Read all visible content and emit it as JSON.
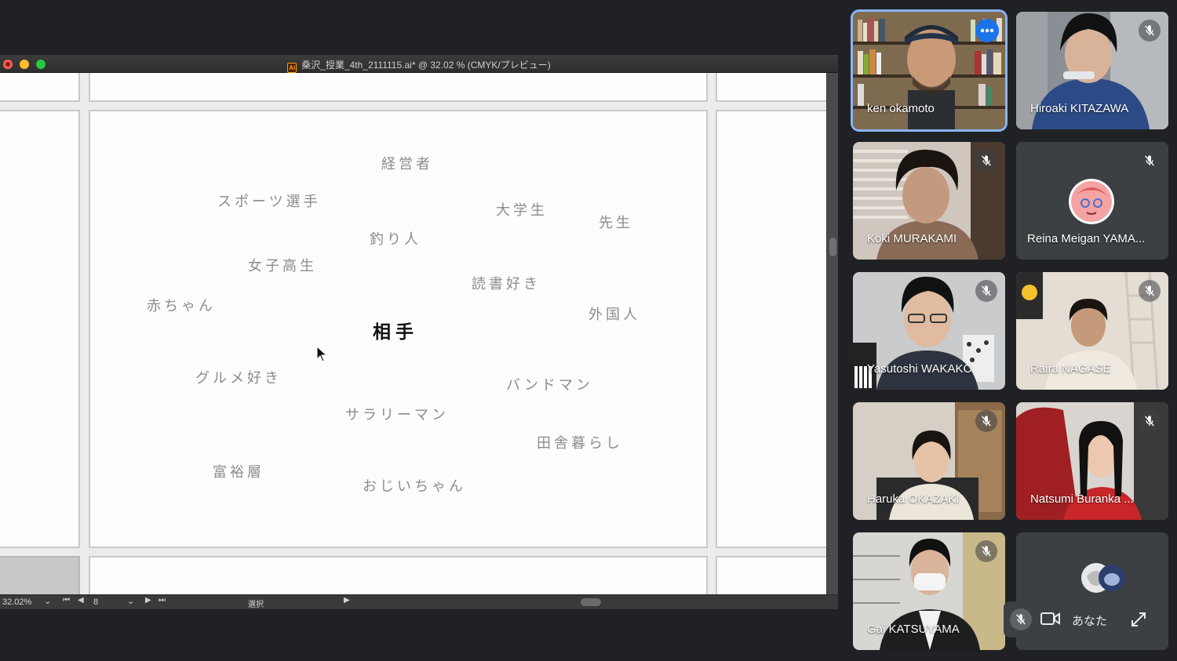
{
  "illustrator": {
    "window_title": "桑沢_授業_4th_2111115.ai* @ 32.02 % (CMYK/プレビュー)",
    "file_icon_label": "Ai",
    "zoom": "32.02%",
    "page": "8",
    "tool": "選択",
    "artboard_words": {
      "center": "相手",
      "w1": "経営者",
      "w2": "スポーツ選手",
      "w3": "大学生",
      "w4": "先生",
      "w5": "釣り人",
      "w6": "女子高生",
      "w7": "読書好き",
      "w8": "赤ちゃん",
      "w9": "外国人",
      "w10": "グルメ好き",
      "w11": "バンドマン",
      "w12": "サラリーマン",
      "w13": "田舎暮らし",
      "w14": "富裕層",
      "w15": "おじいちゃん"
    }
  },
  "meet": {
    "participants": [
      {
        "name": "ken okamoto",
        "muted": false
      },
      {
        "name": "Hiroaki KITAZAWA",
        "muted": true
      },
      {
        "name": "Koki MURAKAMI",
        "muted": true
      },
      {
        "name": "Reina Meigan YAMA...",
        "muted": true
      },
      {
        "name": "Yasutoshi WAKAKO",
        "muted": true
      },
      {
        "name": "Raira NAGASE",
        "muted": true
      },
      {
        "name": "Haruka OKAZAKI",
        "muted": true
      },
      {
        "name": "Natsumi Buranka ...",
        "muted": true
      },
      {
        "name": "Gai KATSUYAMA",
        "muted": true
      }
    ],
    "self": {
      "label": "あなた"
    }
  },
  "colors": {
    "meet_bg": "#202124",
    "tile_bg": "#3c4043",
    "active_outline": "#8ab4f8",
    "more_button": "#1a73e8"
  }
}
